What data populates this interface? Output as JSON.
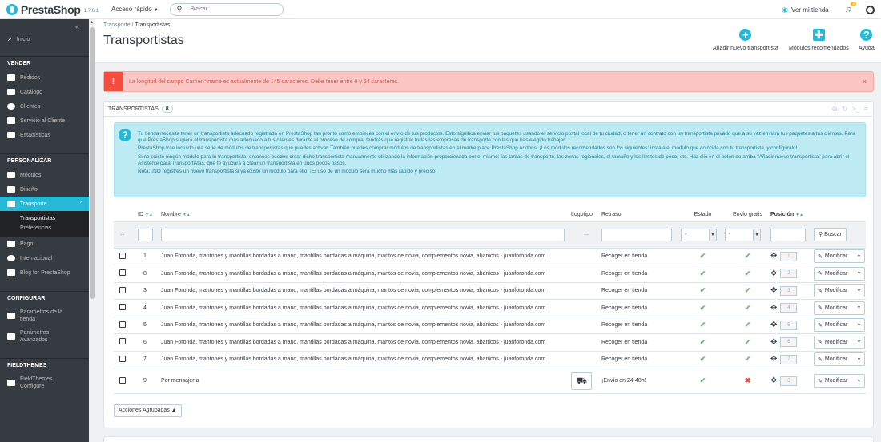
{
  "brand": {
    "name": "PrestaShop",
    "version": "1.7.6.1"
  },
  "topbar": {
    "quick_access": "Acceso rápido",
    "search_placeholder": "Buscar",
    "view_shop": "Ver mi tienda",
    "notif_count": "3"
  },
  "sidebar": {
    "home": "Inicio",
    "sections": [
      {
        "title": "VENDER",
        "items": [
          "Pedidos",
          "Catálogo",
          "Clientes",
          "Servicio al Cliente",
          "Estadísticas"
        ]
      },
      {
        "title": "PERSONALIZAR",
        "items": [
          "Módulos",
          "Diseño",
          "Transporte",
          "Pago",
          "Internacional",
          "Blog for PrestaShop"
        ]
      },
      {
        "title": "CONFIGURAR",
        "items": [
          "Parámetros de la tienda",
          "Parámetros Avanzados"
        ]
      },
      {
        "title": "FIELDTHEMES",
        "items": [
          "FieldThemes Configure"
        ]
      }
    ],
    "transporte_sub": [
      "Transportistas",
      "Preferencias"
    ]
  },
  "breadcrumb": {
    "parent": "Transporte",
    "current": "Transportistas"
  },
  "page_title": "Transportistas",
  "toolbar": {
    "add": "Añadir nuevo transportista",
    "recommended": "Módulos recomendados",
    "help": "Ayuda"
  },
  "alert": "La longitud del campo Carrier->name es actualmente de 145 caracteres. Debe tener entre 0 y 64 caracteres.",
  "panel": {
    "title": "TRANSPORTISTAS",
    "count": "8"
  },
  "info": [
    "Tu tienda necesita tener un transportista adecuado registrado en PrestaShop tan pronto como empieces con el envío de tus productos. Esto significa enviar tus paquetes usando el servicio postal local de tu ciudad, o tener un contrato con un transportista privado que a su vez enviará tus paquetes a tus clientes. Para que PrestaShop sugiera el transportista más adecuado a tus clientes durante el proceso de compra, tendrás que registrar todas las empresas de transporte con las que has elegido trabajar.",
    "PrestaShop trae incluido una serie de módulos de transportistas que puedes activar. También puedes comprar módulos de transportistas en el marketplace PrestaShop Addons. ¡Los módulos recomendados son los siguientes: instala el módulo que coincida con tu transportista, y configúralo!",
    "Si no existe ningún módulo para tu transportista, entonces puedes crear dicho transportista manualmente utilizando la información proporcionada por el mismo: las tarifas de transporte, las zonas regionales, el tamaño y los límites de peso, etc. Haz clic en el botón de arriba \"Añadir nuevo transportista\" para abrir el Asistente para Transportistas, que te ayudará a crear un transportista en unos pocos pasos.",
    "Nota: ¡NO registres un nuevo transportista si ya existe un módulo para ello! ¡El uso de un módulo será mucho más rápido y preciso!"
  ],
  "table": {
    "headers": {
      "id": "ID",
      "name": "Nombre",
      "logo": "Logotipo",
      "delay": "Retraso",
      "status": "Estado",
      "free": "Envío gratis",
      "position": "Posición"
    },
    "filter": {
      "dash": "--",
      "select": "-",
      "search": "Buscar"
    },
    "rows": [
      {
        "id": "1",
        "name": "Juan Foronda, mantones y mantillas bordadas a mano, mantillas bordadas a máquina, mantos de novia, complementos novia, abanicos - juanforonda.com",
        "delay": "Recoger en tienda",
        "status": "✔",
        "free": "✔",
        "pos": "1"
      },
      {
        "id": "8",
        "name": "Juan Foronda, mantones y mantillas bordadas a mano, mantillas bordadas a máquina, mantos de novia, complementos novia, abanicos - juanforonda.com",
        "delay": "Recoger en tienda",
        "status": "✔",
        "free": "✔",
        "pos": "2"
      },
      {
        "id": "3",
        "name": "Juan Foronda, mantones y mantillas bordadas a mano, mantillas bordadas a máquina, mantos de novia, complementos novia, abanicos - juanforonda.com",
        "delay": "Recoger en tienda",
        "status": "✔",
        "free": "✔",
        "pos": "3"
      },
      {
        "id": "4",
        "name": "Juan Foronda, mantones y mantillas bordadas a mano, mantillas bordadas a máquina, mantos de novia, complementos novia, abanicos - juanforonda.com",
        "delay": "Recoger en tienda",
        "status": "✔",
        "free": "✔",
        "pos": "4"
      },
      {
        "id": "5",
        "name": "Juan Foronda, mantones y mantillas bordadas a mano, mantillas bordadas a máquina, mantos de novia, complementos novia, abanicos - juanforonda.com",
        "delay": "Recoger en tienda",
        "status": "✔",
        "free": "✔",
        "pos": "5"
      },
      {
        "id": "6",
        "name": "Juan Foronda, mantones y mantillas bordadas a mano, mantillas bordadas a máquina, mantos de novia, complementos novia, abanicos - juanforonda.com",
        "delay": "Recoger en tienda",
        "status": "✔",
        "free": "✔",
        "pos": "6"
      },
      {
        "id": "7",
        "name": "Juan Foronda, mantones y mantillas bordadas a mano, mantillas bordadas a máquina, mantos de novia, complementos novia, abanicos - juanforonda.com",
        "delay": "Recoger en tienda",
        "status": "✔",
        "free": "✔",
        "pos": "7"
      },
      {
        "id": "9",
        "name": "Por mensajería",
        "delay": "¡Envío en 24-48h!",
        "status": "✔",
        "free": "✖",
        "pos": "8",
        "logo": "truck-icon"
      }
    ],
    "edit_label": "Modificar"
  },
  "bulk_actions": "Acciones Agrupadas"
}
